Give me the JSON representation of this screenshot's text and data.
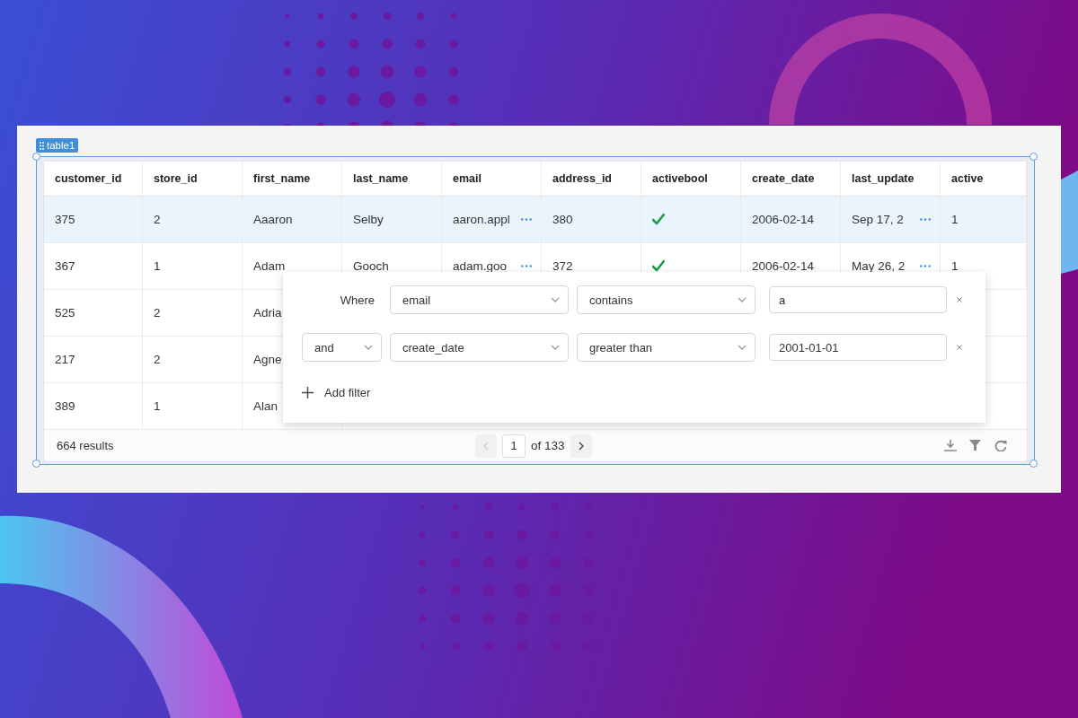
{
  "component_label": "table1",
  "table": {
    "columns": [
      {
        "label": "customer_id",
        "kind": "text"
      },
      {
        "label": "store_id",
        "kind": "text"
      },
      {
        "label": "first_name",
        "kind": "text"
      },
      {
        "label": "last_name",
        "kind": "text"
      },
      {
        "label": "email",
        "kind": "truncated"
      },
      {
        "label": "address_id",
        "kind": "text"
      },
      {
        "label": "activebool",
        "kind": "check"
      },
      {
        "label": "create_date",
        "kind": "text"
      },
      {
        "label": "last_update",
        "kind": "truncated"
      },
      {
        "label": "active",
        "kind": "text"
      }
    ],
    "rows": [
      {
        "selected": true,
        "cells": [
          "375",
          "2",
          "Aaaron",
          "Selby",
          "aaron.appl",
          "380",
          true,
          "2006-02-14",
          "Sep 17, 2",
          "1"
        ]
      },
      {
        "selected": false,
        "cells": [
          "367",
          "1",
          "Adam",
          "Gooch",
          "adam.goo",
          "372",
          true,
          "2006-02-14",
          "May 26, 2",
          "1"
        ]
      },
      {
        "selected": false,
        "cells": [
          "525",
          "2",
          "Adria"
        ]
      },
      {
        "selected": false,
        "cells": [
          "217",
          "2",
          "Agne"
        ]
      },
      {
        "selected": false,
        "cells": [
          "389",
          "1",
          "Alan"
        ]
      }
    ]
  },
  "footer": {
    "results": "664 results",
    "prev_disabled": true,
    "page": "1",
    "page_total": "of 133"
  },
  "filter_popup": {
    "filters": [
      {
        "kind": "where",
        "conjunction": "Where",
        "field": "email",
        "operator": "contains",
        "value": "a"
      },
      {
        "kind": "select",
        "conjunction": "and",
        "field": "create_date",
        "operator": "greater than",
        "value": "2001-01-01"
      }
    ],
    "add_label": "Add filter"
  }
}
